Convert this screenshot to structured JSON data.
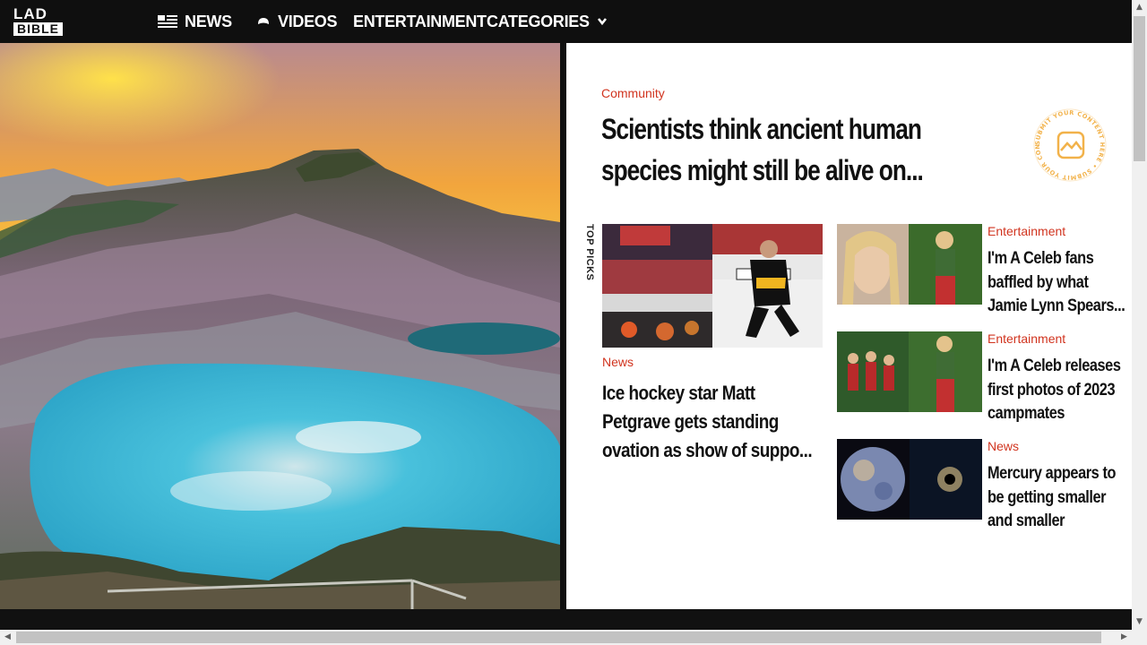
{
  "logo": {
    "line1": "LAD",
    "line2": "BIBLE"
  },
  "nav": {
    "news": "NEWS",
    "videos": "VIDEOS",
    "entertainment": "ENTERTAINMENT",
    "categories": "CATEGORIES"
  },
  "featured": {
    "category": "Community",
    "title": "Scientists think ancient human species might still be alive on..."
  },
  "submit_badge": {
    "text": "SUBMIT YOUR CONTENT HERE • SUBMIT YOUR CONTENT HERE •"
  },
  "top_picks_label": "TOP PICKS",
  "main_card": {
    "category": "News",
    "title": "Ice hockey star Matt Petgrave gets standing ovation as show of suppo..."
  },
  "side_cards": [
    {
      "category": "Entertainment",
      "title": "I'm A Celeb fans baffled by what Jamie Lynn Spears..."
    },
    {
      "category": "Entertainment",
      "title": "I'm A Celeb releases first photos of 2023 campmates"
    },
    {
      "category": "News",
      "title": "Mercury appears to be getting smaller and smaller"
    }
  ],
  "colors": {
    "accent": "#d1341f",
    "nav_bg": "#0f0f0f",
    "badge": "#f2b24a"
  },
  "icons": [
    "news-icon",
    "videos-icon",
    "chevron-down-icon",
    "image-icon"
  ]
}
